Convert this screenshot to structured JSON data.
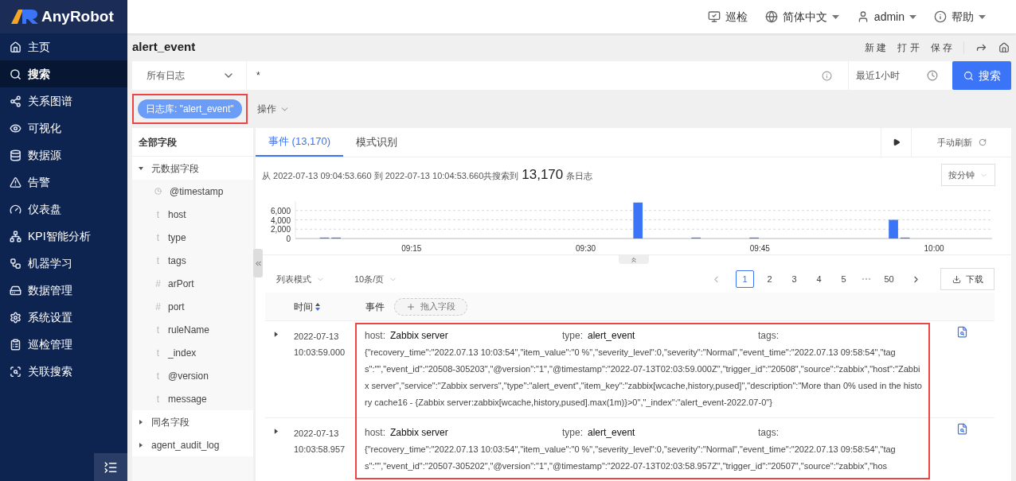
{
  "brand": "AnyRobot",
  "header": {
    "items": [
      {
        "label": "巡检",
        "kind": "inspect"
      },
      {
        "label": "简体中文",
        "kind": "language"
      },
      {
        "label": "admin",
        "kind": "user"
      },
      {
        "label": "帮助",
        "kind": "help"
      }
    ]
  },
  "sidebar": {
    "items": [
      {
        "label": "主页",
        "selected": false
      },
      {
        "label": "搜索",
        "selected": true
      },
      {
        "label": "关系图谱",
        "selected": false
      },
      {
        "label": "可视化",
        "selected": false
      },
      {
        "label": "数据源",
        "selected": false
      },
      {
        "label": "告警",
        "selected": false
      },
      {
        "label": "仪表盘",
        "selected": false
      },
      {
        "label": "KPI智能分析",
        "selected": false
      },
      {
        "label": "机器学习",
        "selected": false
      },
      {
        "label": "数据管理",
        "selected": false
      },
      {
        "label": "系统设置",
        "selected": false
      },
      {
        "label": "巡检管理",
        "selected": false
      },
      {
        "label": "关联搜索",
        "selected": false
      }
    ]
  },
  "page": {
    "title": "alert_event",
    "actions": [
      "新 建",
      "打 开",
      "保 存"
    ]
  },
  "search": {
    "scope": "所有日志",
    "query": "*",
    "time_range": "最近1小时",
    "button": "搜索"
  },
  "index_tag": {
    "label": "日志库: \"alert_event\"",
    "highlighted": true
  },
  "operations": "操作",
  "fields": {
    "title": "全部字段",
    "groups": [
      {
        "label": "元数据字段",
        "expanded": true,
        "children": [
          {
            "name": "@timestamp",
            "kind": "date"
          },
          {
            "name": "host",
            "kind": "typed",
            "symbol": "t"
          },
          {
            "name": "type",
            "kind": "typed",
            "symbol": "t"
          },
          {
            "name": "tags",
            "kind": "typed",
            "symbol": "t"
          },
          {
            "name": "arPort",
            "kind": "typed",
            "symbol": "#"
          },
          {
            "name": "port",
            "kind": "typed",
            "symbol": "#"
          },
          {
            "name": "ruleName",
            "kind": "typed",
            "symbol": "t"
          },
          {
            "name": "_index",
            "kind": "typed",
            "symbol": "t"
          },
          {
            "name": "@version",
            "kind": "typed",
            "symbol": "t"
          },
          {
            "name": "message",
            "kind": "typed",
            "symbol": "t"
          }
        ]
      },
      {
        "label": "同名字段",
        "expanded": false
      },
      {
        "label": "agent_audit_log",
        "expanded": false
      }
    ]
  },
  "tabs": [
    {
      "label": "事件 (13,170)",
      "selected": true
    },
    {
      "label": "模式识别",
      "selected": false
    }
  ],
  "refresh": "手动刷新",
  "summary": {
    "prefix": "从 2022-07-13 09:04:53.660 到 2022-07-13 10:04:53.660共搜索到",
    "count": "13,170",
    "suffix": "条日志"
  },
  "interval": "按分钟",
  "chart_data": {
    "type": "bar",
    "categories": [
      null,
      null,
      null,
      null,
      null,
      null,
      null,
      null,
      null,
      null,
      "09:15",
      null,
      null,
      null,
      null,
      null,
      null,
      null,
      null,
      null,
      null,
      null,
      null,
      null,
      null,
      "09:30",
      null,
      null,
      null,
      null,
      null,
      null,
      null,
      null,
      null,
      null,
      null,
      null,
      null,
      null,
      "09:45",
      null,
      null,
      null,
      null,
      null,
      null,
      null,
      null,
      null,
      null,
      null,
      null,
      null,
      null,
      "10:00",
      null,
      null,
      null,
      null
    ],
    "values": [
      0,
      0,
      200,
      200,
      0,
      0,
      0,
      0,
      0,
      0,
      0,
      0,
      0,
      0,
      0,
      0,
      0,
      0,
      0,
      0,
      0,
      0,
      0,
      0,
      0,
      0,
      0,
      0,
      0,
      7700,
      0,
      0,
      0,
      0,
      200,
      0,
      0,
      0,
      0,
      200,
      0,
      0,
      0,
      0,
      0,
      0,
      0,
      0,
      0,
      0,
      0,
      4000,
      200,
      0,
      0,
      0,
      0,
      0,
      0,
      0
    ],
    "grid": true,
    "ylim": [
      0,
      8000
    ],
    "yticks": [
      {
        "value": 0,
        "label": "0"
      },
      {
        "value": 2000,
        "label": "2,000"
      },
      {
        "value": 4000,
        "label": "4,000"
      },
      {
        "value": 6000,
        "label": "6,000"
      }
    ]
  },
  "view_mode": "列表模式",
  "page_size": "10条/页",
  "pagination": [
    {
      "label": "1",
      "selected": true
    },
    {
      "label": "2",
      "selected": false
    },
    {
      "label": "3",
      "selected": false
    },
    {
      "label": "4",
      "selected": false
    },
    {
      "label": "5",
      "selected": false
    },
    {
      "label": "50",
      "selected": false
    }
  ],
  "download": "下载",
  "table": {
    "columns": [
      "时间",
      "事件"
    ],
    "add_field": "拖入字段",
    "highlighted": true,
    "rows": [
      {
        "expanded": false,
        "date": "2022-07-13",
        "time": "10:03:59.000",
        "labels": {
          "host": "host:",
          "type": "type:",
          "tags": "tags:"
        },
        "host": "Zabbix server",
        "type": "alert_event",
        "message": "{\"recovery_time\":\"2022.07.13 10:03:54\",\"item_value\":\"0 %\",\"severity_level\":0,\"severity\":\"Normal\",\"event_time\":\"2022.07.13 09:58:54\",\"tags\":\"\",\"event_id\":\"20508-305203\",\"@version\":\"1\",\"@timestamp\":\"2022-07-13T02:03:59.000Z\",\"trigger_id\":\"20508\",\"source\":\"zabbix\",\"host\":\"Zabbix server\",\"service\":\"Zabbix servers\",\"type\":\"alert_event\",\"item_key\":\"zabbix[wcache,history,pused]\",\"description\":\"More than 0% used in the history cache16 - {Zabbix server:zabbix[wcache,history,pused].max(1m)}>0\",\"_index\":\"alert_event-2022.07-0\"}"
      },
      {
        "expanded": false,
        "date": "2022-07-13",
        "time": "10:03:58.957",
        "labels": {
          "host": "host:",
          "type": "type:",
          "tags": "tags:"
        },
        "host": "Zabbix server",
        "type": "alert_event",
        "message": "{\"recovery_time\":\"2022.07.13 10:03:54\",\"item_value\":\"0 %\",\"severity_level\":0,\"severity\":\"Normal\",\"event_time\":\"2022.07.13 09:58:54\",\"tags\":\"\",\"event_id\":\"20507-305202\",\"@version\":\"1\",\"@timestamp\":\"2022-07-13T02:03:58.957Z\",\"trigger_id\":\"20507\",\"source\":\"zabbix\",\"hos"
      }
    ]
  }
}
